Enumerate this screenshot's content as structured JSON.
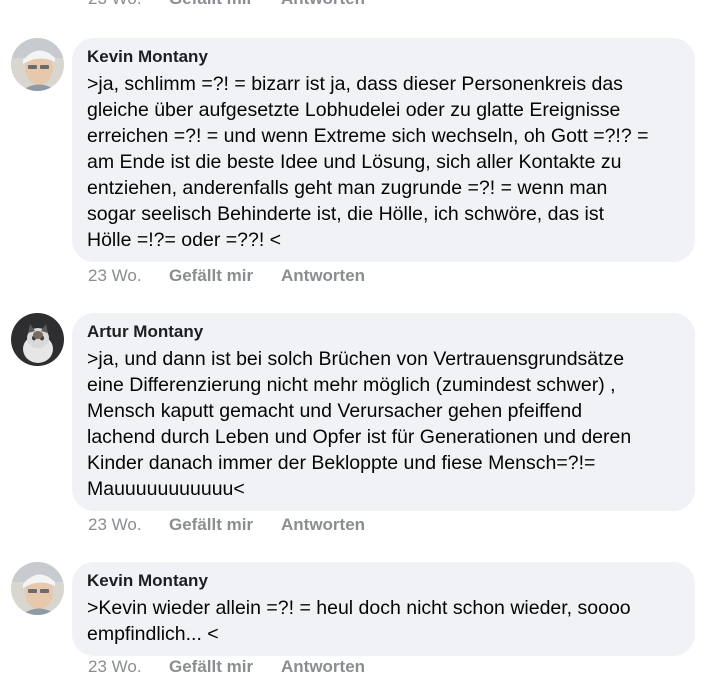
{
  "actions": {
    "time": "23 Wo.",
    "like": "Gefällt mir",
    "reply": "Antworten"
  },
  "comments": [
    {
      "author": "Kevin Montany",
      "text": ">ja, schlimm =?! = bizarr ist ja, dass dieser Personenkreis das\ngleiche über aufgesetzte Lobhudelei oder zu glatte Ereignisse\nerreichen =?! = und wenn Extreme sich wechseln, oh Gott =?!? =\nam Ende ist die beste Idee und Lösung, sich aller Kontakte zu\nentziehen, anderenfalls geht man zugrunde =?! = wenn man\nsogar seelisch Behinderte ist, die Hölle, ich schwöre, das ist\nHölle =!?= oder =??! <",
      "time": "23 Wo.",
      "like": "Gefällt mir",
      "reply": "Antworten"
    },
    {
      "author": "Artur Montany",
      "text": ">ja, und dann ist bei solch Brüchen von Vertrauensgrundsätze\neine Differenzierung nicht mehr möglich (zumindest schwer) ,\nMensch kaputt gemacht und Verursacher gehen pfeiffend\nlachend durch Leben und  Opfer ist für Generationen und deren\nKinder danach immer der Bekloppte und fiese Mensch=?!=\nMauuuuuuuuuuu<",
      "time": "23 Wo.",
      "like": "Gefällt mir",
      "reply": "Antworten"
    },
    {
      "author": "Kevin Montany",
      "text": ">Kevin wieder allein =?! = heul doch nicht schon wieder, soooo\nempfindlich... <",
      "time": "23 Wo.",
      "like": "Gefällt mir",
      "reply": "Antworten"
    }
  ]
}
